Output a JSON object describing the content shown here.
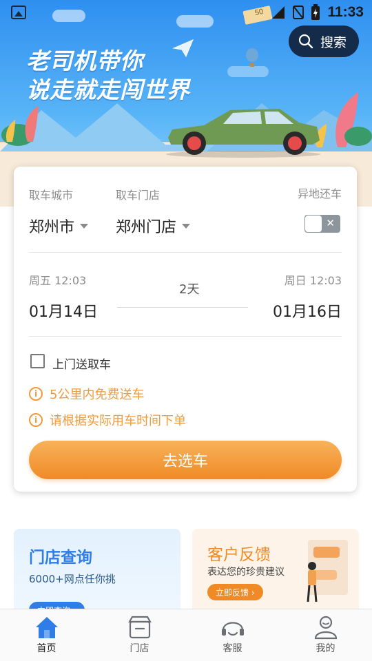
{
  "status_bar": {
    "time": "11:33"
  },
  "hero": {
    "title_line1": "老司机带你",
    "title_line2": "说走就走闯世界",
    "search_label": "搜索",
    "flyer_number": "50"
  },
  "booking": {
    "pickup_city_label": "取车城市",
    "pickup_city_value": "郑州市",
    "pickup_store_label": "取车门店",
    "pickup_store_value": "郑州门店",
    "return_elsewhere_label": "异地还车",
    "return_elsewhere_on": false,
    "start_weekday_time": "周五 12:03",
    "start_date": "01月14日",
    "duration": "2天",
    "end_weekday_time": "周日 12:03",
    "end_date": "01月16日",
    "door_delivery_label": "上门送取车",
    "door_delivery_checked": false,
    "notes": [
      "5公里内免费送车",
      "请根据实际用车时间下单"
    ],
    "cta_label": "去选车"
  },
  "tiles": {
    "left": {
      "title": "门店查询",
      "subtitle": "6000+网点任你挑",
      "button": "立即查询 ›"
    },
    "right": {
      "title": "客户反馈",
      "subtitle": "表达您的珍贵建议",
      "button": "立即反馈 ›"
    }
  },
  "tabs": [
    {
      "label": "首页",
      "icon": "home-icon",
      "active": true
    },
    {
      "label": "门店",
      "icon": "store-icon",
      "active": false
    },
    {
      "label": "客服",
      "icon": "headset-icon",
      "active": false
    },
    {
      "label": "我的",
      "icon": "person-icon",
      "active": false
    }
  ],
  "colors": {
    "hero_blue": "#2f8ff0",
    "accent_orange": "#f08a26",
    "search_bg": "#152b4a",
    "tab_active": "#2f7ee8",
    "tab_inactive": "#6b6f75"
  }
}
